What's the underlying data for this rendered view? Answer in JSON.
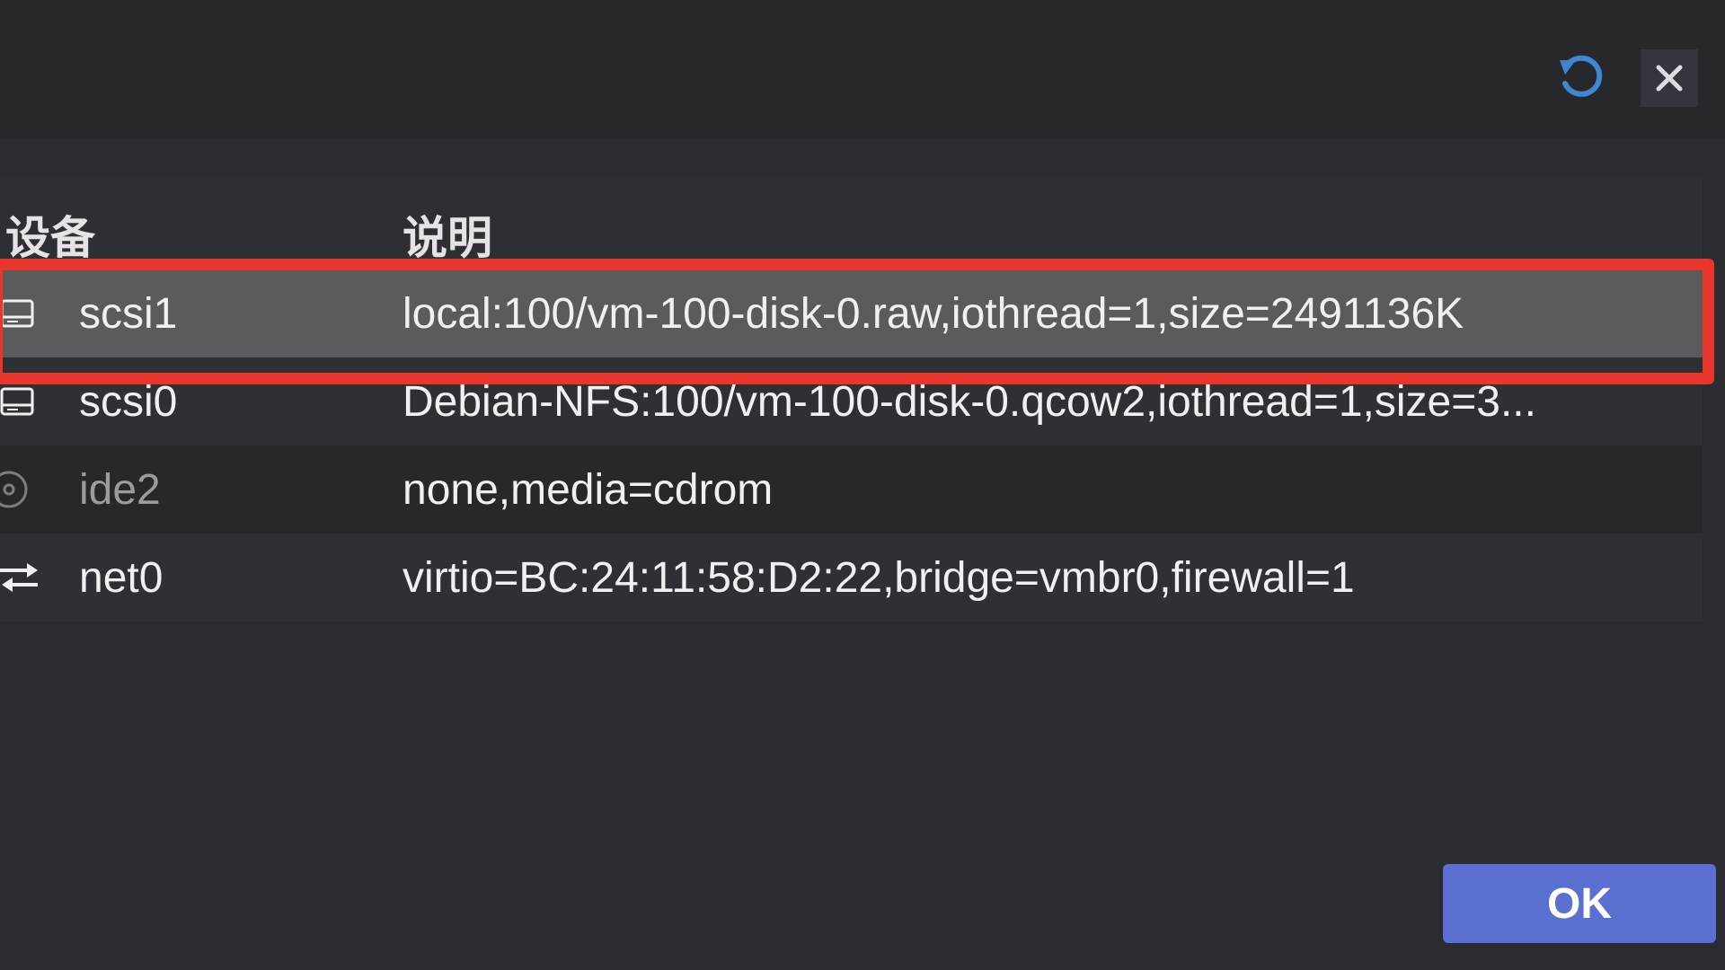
{
  "toolbar": {
    "refresh_icon": "refresh-icon",
    "close_icon": "close-icon",
    "accent_color": "#4a8fd6"
  },
  "grid": {
    "columns": [
      "设备",
      "说明"
    ],
    "rows": [
      {
        "icon": "harddisk-icon",
        "device": "scsi1",
        "description": "local:100/vm-100-disk-0.raw,iothread=1,size=2491136K",
        "selected": true,
        "highlighted": true
      },
      {
        "icon": "harddisk-icon",
        "device": "scsi0",
        "description": "Debian-NFS:100/vm-100-disk-0.qcow2,iothread=1,size=3...",
        "selected": false
      },
      {
        "icon": "cdrom-icon",
        "device": "ide2",
        "description": "none,media=cdrom",
        "selected": false,
        "muted": true
      },
      {
        "icon": "network-icon",
        "device": "net0",
        "description": "virtio=BC:24:11:58:D2:22,bridge=vmbr0,firewall=1",
        "selected": false
      }
    ]
  },
  "footer": {
    "ok_label": "OK"
  },
  "colors": {
    "highlight_border": "#e8362c",
    "ok_button": "#5a6fd0",
    "selected_row": "#5a5b5e"
  }
}
